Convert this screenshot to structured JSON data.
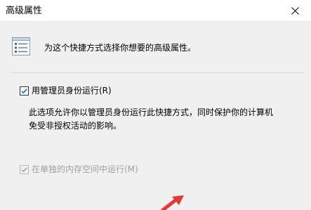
{
  "window": {
    "title": "高级属性"
  },
  "header": {
    "description": "为这个快捷方式选择你想要的高级属性。",
    "icon": "property-list-icon"
  },
  "options": {
    "run_as_admin": {
      "label": "用管理员身份运行(R)",
      "checked": true
    },
    "run_as_admin_description": {
      "line1": "此选项允许你以管理员身份运行此快捷方式，同时保护你的计算机",
      "line2": "免受非授权活动的影响。"
    },
    "separate_memory": {
      "label": "在单独的内存空间中运行(M)",
      "checked": true,
      "disabled": true
    }
  },
  "colors": {
    "accent": "#0078d7",
    "annotation_arrow": "#e53935"
  }
}
